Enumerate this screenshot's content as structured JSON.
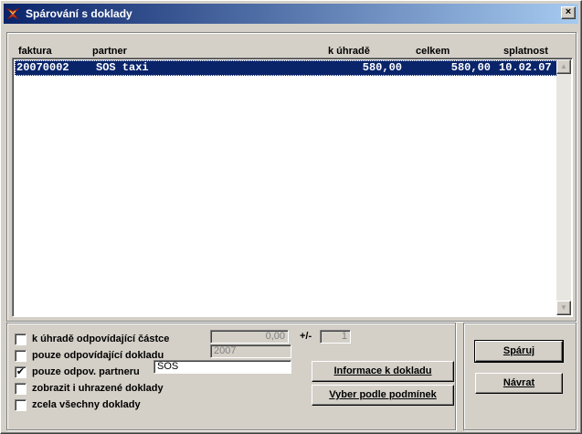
{
  "window": {
    "title": "Spárování s doklady",
    "close_glyph": "×"
  },
  "grid": {
    "columns": [
      "faktura",
      "partner",
      "k úhradě",
      "celkem",
      "splatnost"
    ],
    "rows": [
      {
        "faktura": "20070002",
        "partner": "SOS taxi",
        "k_uhrade": "580,00",
        "celkem": "580,00",
        "splatnost": "10.02.07"
      }
    ],
    "scroll_up": "▲",
    "scroll_down": "▼"
  },
  "filters": {
    "k_uhrade_label": "k úhradě odpovídající částce",
    "k_uhrade_checked": false,
    "k_uhrade_value": "0,00",
    "plusminus_label": "+/-",
    "tolerance_value": "1",
    "dokladu_label": "pouze odpovídající dokladu",
    "dokladu_checked": false,
    "dokladu_value": "2007",
    "partneru_label": "pouze odpov. partneru",
    "partneru_checked": true,
    "partneru_value": "SOS",
    "uhrazene_label": "zobrazit i uhrazené doklady",
    "uhrazene_checked": false,
    "vse_label": "zcela všechny doklady",
    "vse_checked": false
  },
  "buttons": {
    "info": "Informace k dokladu",
    "vyber": "Vyber podle podmínek",
    "sparuj": "Spáruj",
    "navrat": "Návrat"
  },
  "icons": {
    "app": "app-icon",
    "check": "✔"
  }
}
